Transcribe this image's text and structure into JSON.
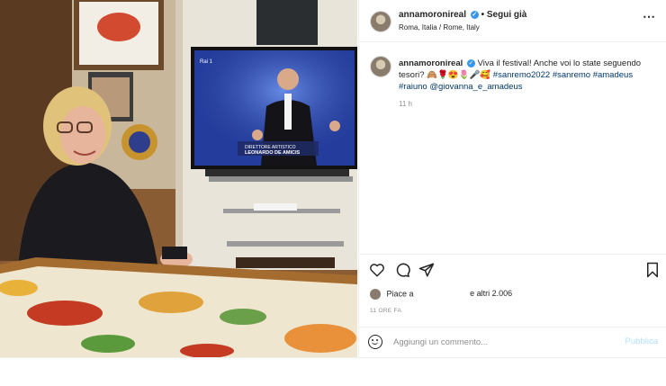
{
  "header": {
    "username": "annamoronireal",
    "follow_label": "Segui già",
    "location": "Roma, Italia / Rome, Italy",
    "more_icon": "more-options-icon"
  },
  "caption": {
    "username": "annamoronireal",
    "text": "Viva il festival! Anche voi lo state seguendo tesori?",
    "emojis": "🙈🌹😍🌷🎤🥰",
    "hashtags": [
      "#sanremo2022",
      "#sanremo",
      "#amadeus",
      "#raiuno"
    ],
    "mention": "@giovanna_e_amadeus",
    "time": "11 h"
  },
  "photo": {
    "tv_banner_line1": "DIRETTORE ARTISTICO",
    "tv_banner_line2": "LEONARDO DE AMICIS",
    "tv_logo": "Rai 1"
  },
  "actions": {
    "like_icon": "heart-icon",
    "comment_icon": "comment-icon",
    "share_icon": "share-icon",
    "save_icon": "bookmark-icon"
  },
  "likes": {
    "prefix": "Piace a",
    "suffix": "e altri 2.006"
  },
  "timestamp": "11 ORE FA",
  "comment_box": {
    "placeholder": "Aggiungi un commento...",
    "publish_label": "Pubblica"
  },
  "colors": {
    "verified": "#3897f0",
    "link": "#00376b",
    "publish_disabled": "#b2dffc"
  }
}
